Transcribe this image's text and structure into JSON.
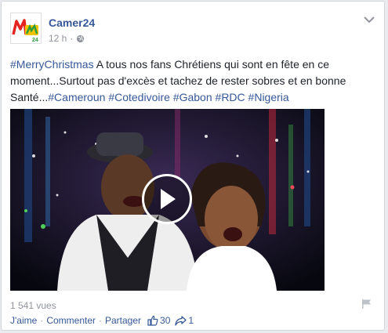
{
  "post": {
    "page_name": "Camer24",
    "time": "12 h",
    "separator": "·",
    "text": {
      "hashtag_1": "#MerryChristmas",
      "body": " A tous nos fans Chrétiens qui sont en fête en ce moment...Surtout pas d'excès et tachez de rester sobres et en bonne Santé...",
      "hashtags": [
        "#Cameroun",
        "#Cotedivoire",
        "#Gabon",
        "#RDC",
        "#Nigeria"
      ]
    },
    "views": "1 541 vues",
    "actions": {
      "like": "J'aime",
      "comment": "Commenter",
      "share": "Partager",
      "sep": "·",
      "likes_count": "30",
      "shares_count": "1"
    },
    "colors": {
      "link": "#365899",
      "meta": "#90949c",
      "text": "#1d2129"
    },
    "icons": [
      "camer24-logo",
      "globe-icon",
      "chevron-down-icon",
      "play-icon",
      "flag-icon",
      "thumbs-up-icon",
      "share-arrow-icon"
    ]
  }
}
